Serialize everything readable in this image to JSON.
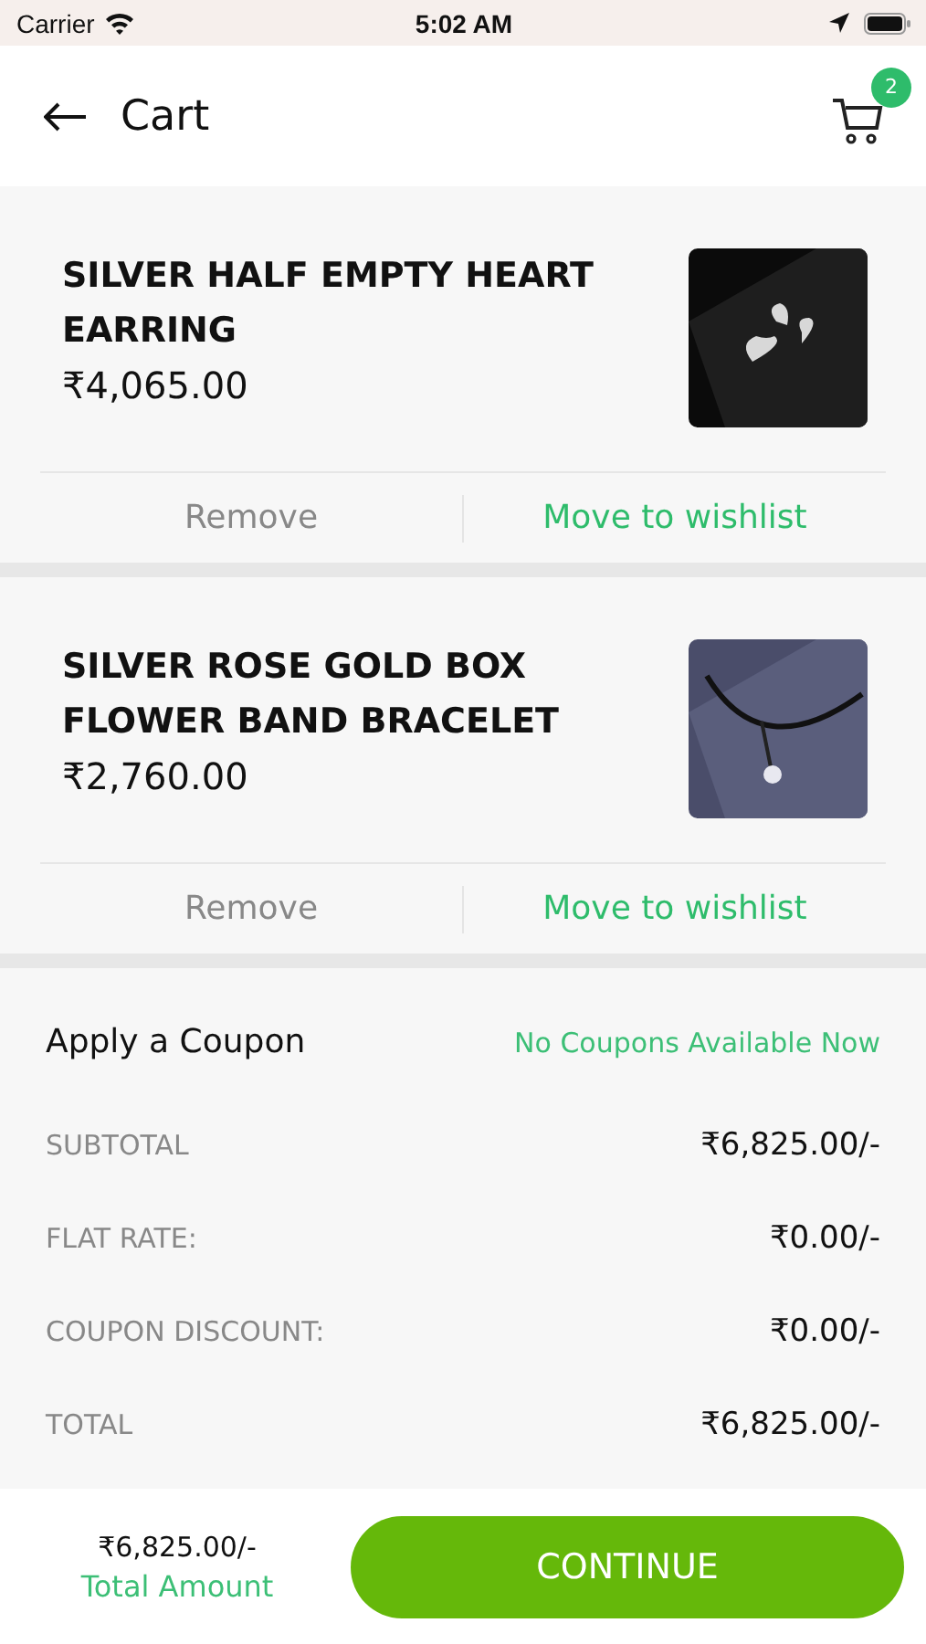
{
  "status_bar": {
    "carrier": "Carrier",
    "time": "5:02 AM"
  },
  "header": {
    "title": "Cart",
    "cart_count": "2"
  },
  "items": [
    {
      "name": "SILVER HALF EMPTY HEART EARRING",
      "price": "₹4,065.00",
      "remove": "Remove",
      "wishlist": "Move to wishlist"
    },
    {
      "name": "SILVER ROSE GOLD BOX FLOWER BAND BRACELET",
      "price": "₹2,760.00",
      "remove": "Remove",
      "wishlist": "Move to wishlist"
    }
  ],
  "coupon": {
    "label": "Apply a Coupon",
    "status": "No Coupons Available Now"
  },
  "summary": [
    {
      "label": "SUBTOTAL",
      "value": "₹6,825.00/-"
    },
    {
      "label": "FLAT RATE:",
      "value": "₹0.00/-"
    },
    {
      "label": "COUPON DISCOUNT:",
      "value": "₹0.00/-"
    },
    {
      "label": "TOTAL",
      "value": "₹6,825.00/-"
    }
  ],
  "footer": {
    "amount": "₹6,825.00/-",
    "amount_label": "Total Amount",
    "button": "CONTINUE"
  }
}
